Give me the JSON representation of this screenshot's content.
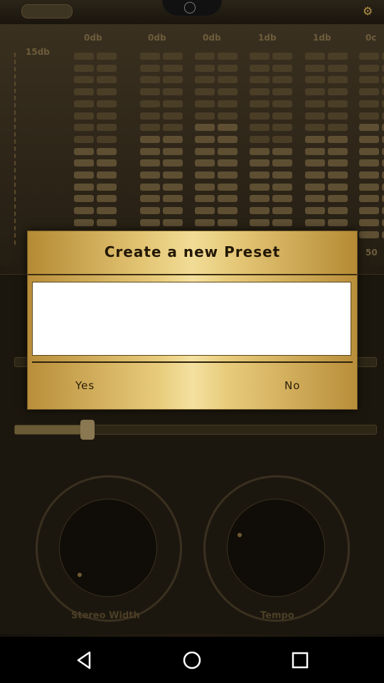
{
  "dialog": {
    "title": "Create a new Preset",
    "input_value": "",
    "yes_label": "Yes",
    "no_label": "No"
  },
  "background": {
    "eq_band_labels": [
      "0db",
      "0db",
      "0db",
      "1db",
      "1db",
      "0c"
    ],
    "scale_label": "15db",
    "right_label": "50",
    "knob_labels": [
      "Stereo Width",
      "Tempo"
    ]
  },
  "navbar": {
    "back": "back-icon",
    "home": "home-icon",
    "recents": "recents-icon"
  },
  "colors": {
    "dialog_gold": "#e3c574",
    "dialog_text": "#231806",
    "navbar_bg": "#000000"
  }
}
